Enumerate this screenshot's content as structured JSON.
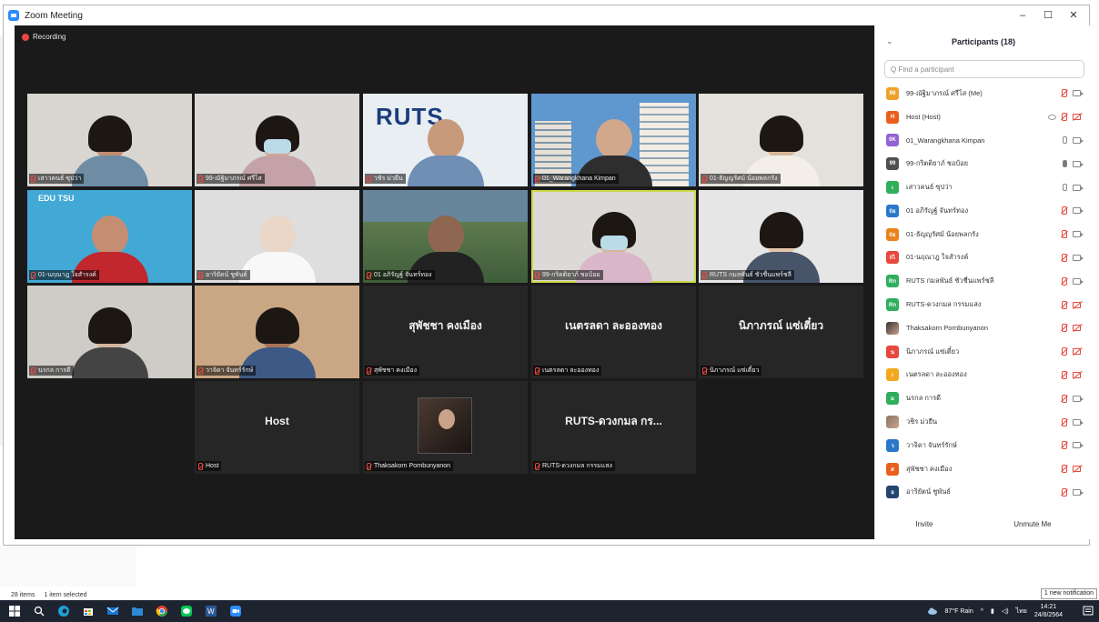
{
  "window": {
    "title": "Zoom Meeting",
    "minimize_glyph": "–",
    "maximize_glyph": "☐",
    "close_glyph": "✕"
  },
  "meeting": {
    "recording_label": "Recording"
  },
  "tiles": [
    {
      "label": "เสาวคนธ์ ซุปว่า",
      "type": "video",
      "bg": "#d9d6d2",
      "skin": "#c08d6e",
      "shirt": "#6e8da4",
      "hair": true,
      "mask": false
    },
    {
      "label": "99-ณัฐิมาภรณ์ ศรีไส",
      "type": "video",
      "bg": "#dcdad8",
      "skin": "#d3a88f",
      "shirt": "#c4a2a7",
      "hair": true,
      "mask": true
    },
    {
      "label": "วชิร ม่วยืน",
      "type": "logo",
      "bg": "#e9eef3",
      "logo_text": "RUTS",
      "skin": "#c89a7c",
      "shirt": "#6f8fb5"
    },
    {
      "label": "01_Warangkhana Kimpan",
      "type": "building",
      "bg": "#5f97cf",
      "skin": "#d2a88c",
      "shirt": "#2e2e2e"
    },
    {
      "label": "01-ธัญญรัศม์ น้อยพลกรัง",
      "type": "video",
      "bg": "#e4e1dc",
      "skin": "#d8b79b",
      "shirt": "#f3efe8",
      "hair": true,
      "mask": false
    },
    {
      "label": "01-นฤณาฎ ใจสำรงค์",
      "type": "edu",
      "bg": "#42a9d6",
      "logo_text": "EDU TSU",
      "skin": "#c58d72",
      "shirt": "#c1272d"
    },
    {
      "label": "อาริยัตน์ ชูพันธ์",
      "type": "video",
      "bg": "#dedede",
      "skin": "#ead7c8",
      "shirt": "#f8f8f8",
      "hair": false,
      "mask": false
    },
    {
      "label": "01 อภิรัญฐ์ จันทร์ทอง",
      "type": "aerial",
      "bg": "#67859b",
      "skin": "#8f6650",
      "shirt": "#222222"
    },
    {
      "label": "99-กริตติยาภ์ ชอบ้อย",
      "type": "video",
      "bg": "#dcdad6",
      "skin": "#d7b49a",
      "shirt": "#d9b7c9",
      "hair": true,
      "mask": true,
      "active": true
    },
    {
      "label": "RUTS กมลพันธ์ ชัวชื่นแพร์ชลี",
      "type": "video",
      "bg": "#e6e6e6",
      "skin": "#e3c3aa",
      "shirt": "#48546a",
      "hair": true,
      "mask": false
    },
    {
      "label": "นรกล การดี",
      "type": "video",
      "bg": "#cfccc8",
      "skin": "#d4b49c",
      "shirt": "#444444",
      "hair": true,
      "mask": false
    },
    {
      "label": "วาจิดา จันทร์รักษ์",
      "type": "video",
      "bg": "#caa784",
      "skin": "#a97258",
      "shirt": "#3d5a86",
      "hair": true,
      "mask": false
    },
    {
      "label": "สุพัชชา คงเมือง",
      "type": "name",
      "name": "สุพัชชา คงเมือง"
    },
    {
      "label": "เนตรลดา ละอองทอง",
      "type": "name",
      "name": "เนตรลดา ละอองทอง"
    },
    {
      "label": "นิภาภรณ์ แซ่เตี๋ยว",
      "type": "name",
      "name": "นิภาภรณ์ แซ่เตี๋ยว"
    },
    {
      "label": "Host",
      "type": "name",
      "name": "Host"
    },
    {
      "label": "Thaksakorn Pornbunyanon",
      "type": "photo"
    },
    {
      "label": "RUTS-ดวงกมล กรรมแสง",
      "type": "name",
      "name": "RUTS-ดวงกมล กร..."
    }
  ],
  "participants": {
    "title": "Participants (18)",
    "collapse_glyph": "⌄",
    "search_placeholder": "Q Find a participant",
    "items": [
      {
        "initials": "99",
        "color": "#f0a12c",
        "name": "99-ณัฐิมาภรณ์ ศรีไส (Me)",
        "mic": "off",
        "video": "on"
      },
      {
        "initials": "H",
        "color": "#e8601c",
        "name": "Host (Host)",
        "mic": "off",
        "video": "off",
        "host": true
      },
      {
        "initials": "0K",
        "color": "#9362d4",
        "name": "01_Warangkhana Kimpan",
        "mic": "on",
        "video": "on"
      },
      {
        "initials": "99",
        "color": "#4f4f4f",
        "name": "99-กริตติยาภ์ ชอบ้อย",
        "mic": "talk",
        "video": "on"
      },
      {
        "initials": "เ",
        "color": "#2fae5b",
        "name": "เสาวคนธ์ ซุปว่า",
        "mic": "on",
        "video": "on"
      },
      {
        "initials": "0อ",
        "color": "#2a78c9",
        "name": "01 อภิรัญฐ์ จันทร์ทอง",
        "mic": "off",
        "video": "on"
      },
      {
        "initials": "0ธ",
        "color": "#e8831c",
        "name": "01-ธัญญรัศม์ น้อยพลกรัง",
        "mic": "off",
        "video": "on"
      },
      {
        "initials": "0ไ",
        "color": "#e5483d",
        "name": "01-นฤณาฎ ใจสำรงค์",
        "mic": "off",
        "video": "on"
      },
      {
        "initials": "Rก",
        "color": "#2fae5b",
        "name": "RUTS กมลพันธ์ ชัวชื่นแพร์ชลี",
        "mic": "off",
        "video": "on"
      },
      {
        "initials": "Rก",
        "color": "#2fae5b",
        "name": "RUTS-ดวงกมล กรรมแสง",
        "mic": "off",
        "video": "off"
      },
      {
        "initials": "",
        "color": "#333333",
        "name": "Thaksakorn Pornbunyanon",
        "mic": "off",
        "video": "off",
        "photo": true
      },
      {
        "initials": "น",
        "color": "#e5483d",
        "name": "นิภาภรณ์ แซ่เตี๋ยว",
        "mic": "off",
        "video": "off"
      },
      {
        "initials": "เ",
        "color": "#f2a81d",
        "name": "เนตรลดา ละอองทอง",
        "mic": "off",
        "video": "off"
      },
      {
        "initials": "ม",
        "color": "#2fae5b",
        "name": "นรกล การดี",
        "mic": "off",
        "video": "on"
      },
      {
        "initials": "",
        "color": "#8a7766",
        "name": "วชิร ม่วยืน",
        "mic": "off",
        "video": "on",
        "photo": true
      },
      {
        "initials": "ว",
        "color": "#2a78c9",
        "name": "วาจิดา จันทร์รักษ์",
        "mic": "off",
        "video": "on"
      },
      {
        "initials": "ส",
        "color": "#e8601c",
        "name": "สุพัชชา คงเมือง",
        "mic": "off",
        "video": "off"
      },
      {
        "initials": "อ",
        "color": "#23456e",
        "name": "อาริยัตน์ ชูพันธ์",
        "mic": "off",
        "video": "on"
      }
    ],
    "invite_label": "Invite",
    "unmute_label": "Unmute Me"
  },
  "explorer_status": {
    "items_count": "28 items",
    "selected": "1 item selected"
  },
  "notification": "1 new notification",
  "taskbar": {
    "weather": "87°F Rain",
    "time": "14:21",
    "date": "24/8/2564"
  }
}
